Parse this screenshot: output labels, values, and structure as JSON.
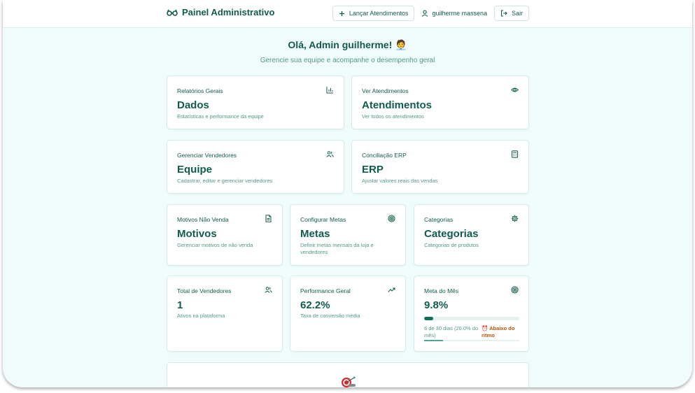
{
  "header": {
    "brand": "Painel Administrativo",
    "launch_button": "Lançar Atendimentos",
    "user_name": "guilherme massena",
    "logout_button": "Sair"
  },
  "greeting": {
    "title": "Olá, Admin guilherme! 🧑‍💼",
    "subtitle": "Gerencie sua equipe e acompanhe o desempenho geral"
  },
  "nav_cards": [
    {
      "label": "Relatórios Gerais",
      "value": "Dados",
      "desc": "Estatísticas e performance da equipe",
      "icon": "bar-chart-icon"
    },
    {
      "label": "Ver Atendimentos",
      "value": "Atendimentos",
      "desc": "Ver todos os atendimentos",
      "icon": "eye-icon"
    },
    {
      "label": "Gerenciar Vendedores",
      "value": "Equipe",
      "desc": "Cadastrar, editar e gerenciar vendedores",
      "icon": "users-icon"
    },
    {
      "label": "Conciliação ERP",
      "value": "ERP",
      "desc": "Ajustar valores reais das vendas",
      "icon": "calculator-icon"
    },
    {
      "label": "Motivos Não Venda",
      "value": "Motivos",
      "desc": "Gerenciar motivos de não venda",
      "icon": "document-icon"
    },
    {
      "label": "Configurar Metas",
      "value": "Metas",
      "desc": "Definir metas mensais da loja e vendedores",
      "icon": "target-icon"
    },
    {
      "label": "Categorias",
      "value": "Categorias",
      "desc": "Categorias de produtos",
      "icon": "gear-icon"
    }
  ],
  "stats": {
    "total_sellers": {
      "label": "Total de Vendedores",
      "value": "1",
      "desc": "Ativos na plataforma",
      "icon": "users-icon"
    },
    "performance": {
      "label": "Performance Geral",
      "value": "62.2%",
      "desc": "Taxa de conversão média",
      "icon": "trending-up-icon"
    },
    "month_goal": {
      "label": "Meta do Mês",
      "value": "9.8%",
      "progress": 0.098,
      "days_progress": 0.2,
      "days_text": "6 de 30 dias (20.0% do mês)",
      "warning": "⏰ Abaixo do ritmo",
      "icon": "target-icon"
    }
  },
  "colors": {
    "primary": "#0f5c4e",
    "muted": "#4f9a8c",
    "background": "#f0fcfb",
    "warning": "#b45309"
  }
}
